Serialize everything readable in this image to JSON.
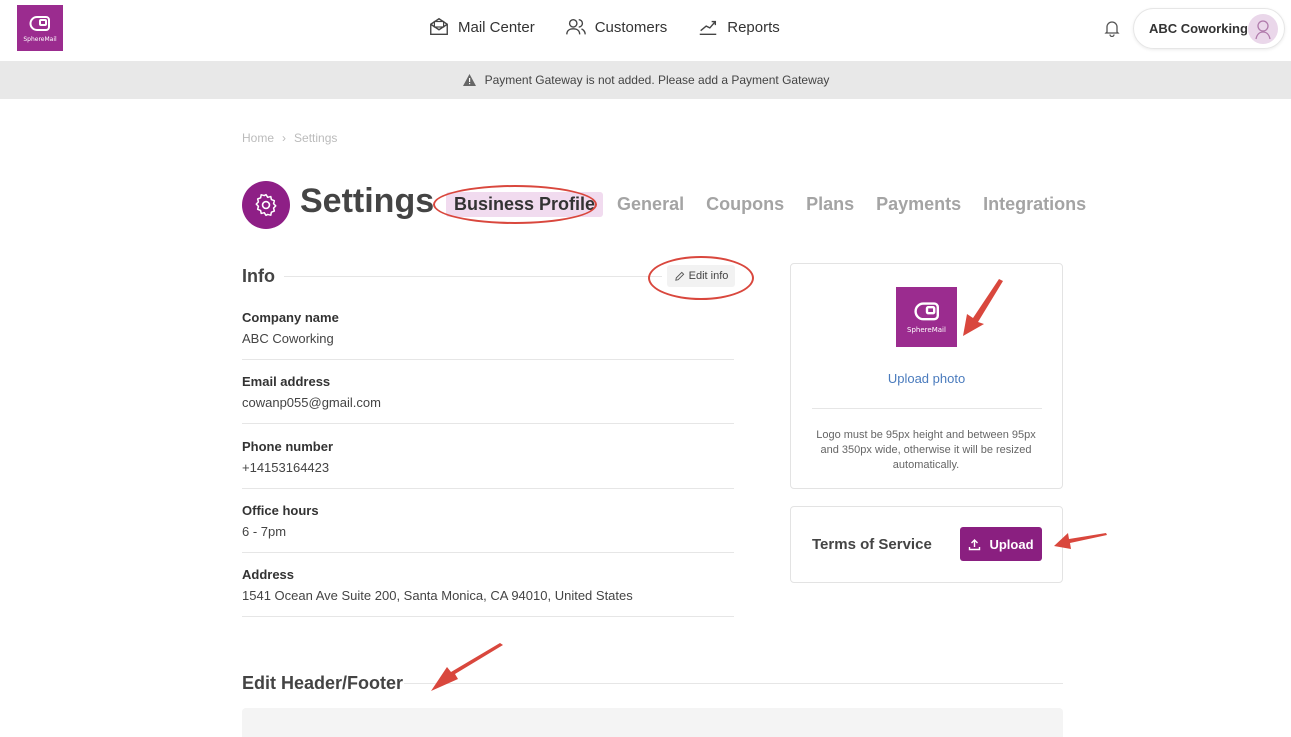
{
  "brand": {
    "logo_text": "SphereMail",
    "color": "#9b2c8f"
  },
  "nav": {
    "items": [
      {
        "label": "Mail Center",
        "icon": "mail-icon"
      },
      {
        "label": "Customers",
        "icon": "users-icon"
      },
      {
        "label": "Reports",
        "icon": "chart-line-icon"
      }
    ]
  },
  "account": {
    "name": "ABC Coworking"
  },
  "banner": {
    "text": "Payment Gateway is not added. Please add a  Payment Gateway"
  },
  "breadcrumb": {
    "home": "Home",
    "separator": "›",
    "current": "Settings"
  },
  "page": {
    "title": "Settings"
  },
  "tabs": [
    {
      "label": "Business Profile",
      "active": true
    },
    {
      "label": "General",
      "active": false
    },
    {
      "label": "Coupons",
      "active": false
    },
    {
      "label": "Plans",
      "active": false
    },
    {
      "label": "Payments",
      "active": false
    },
    {
      "label": "Integrations",
      "active": false
    }
  ],
  "info": {
    "title": "Info",
    "edit_label": "Edit info",
    "fields": [
      {
        "label": "Company name",
        "value": "ABC Coworking"
      },
      {
        "label": "Email address",
        "value": "cowanp055@gmail.com"
      },
      {
        "label": "Phone number",
        "value": "+14153164423"
      },
      {
        "label": "Office hours",
        "value": "6 - 7pm"
      },
      {
        "label": "Address",
        "value": "1541 Ocean Ave Suite 200, Santa Monica, CA 94010, United States"
      }
    ]
  },
  "logo_card": {
    "logo_text": "SphereMail",
    "upload_label": "Upload photo",
    "note": "Logo must be 95px height and between 95px and 350px wide, otherwise it will be resized automatically."
  },
  "tos_card": {
    "label": "Terms of Service",
    "button_label": "Upload"
  },
  "header_footer": {
    "title": "Edit Header/Footer"
  },
  "colors": {
    "accent": "#8a1f80",
    "annotation": "#d9473d",
    "link": "#4a7bbd"
  }
}
